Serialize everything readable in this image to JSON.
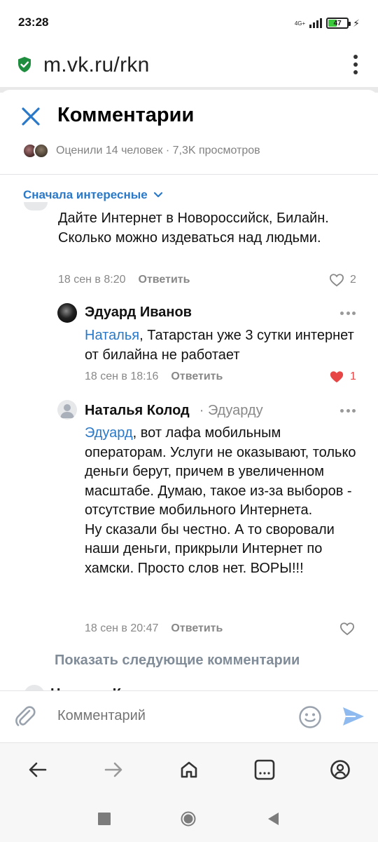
{
  "status": {
    "time": "23:28",
    "network": "4G+",
    "battery": "47",
    "battery_level": 0.47
  },
  "browser": {
    "url": "m.vk.ru/rkn"
  },
  "sheet": {
    "title": "Комментарии",
    "likers_text": "Оценили 14 человек · 7,3K просмотров",
    "sort_label": "Сначала интересные"
  },
  "comments": [
    {
      "text": "Дайте Интернет в Новороссийск, Билайн. Сколько можно издеваться над людьми.",
      "date": "18 сен в 8:20",
      "reply": "Ответить",
      "likes": "2"
    },
    {
      "author": "Эдуард Иванов",
      "mention": "Наталья",
      "text": ", Татарстан уже 3 сутки интернет от билайна не работает",
      "date": "18 сен в 18:16",
      "reply": "Ответить",
      "likes": "1"
    },
    {
      "author": "Наталья Колод",
      "reply_to": "· Эдуарду",
      "mention": "Эдуард",
      "text": ", вот лафа мобильным операторам. Услуги не оказывают, только деньги берут, причем в увеличенном масштабе. Думаю, такое из-за выборов - отсутствие мобильного Интернета.\nНу сказали бы честно. А то своровали наши деньги, прикрыли Интернет по хамски. Просто слов нет. ВОРЫ!!!",
      "date": "18 сен в 20:47",
      "reply": "Ответить"
    }
  ],
  "show_more": "Показать следующие комментарии",
  "peek_author": "Наталья Колод",
  "composer": {
    "placeholder": "Комментарий"
  },
  "colors": {
    "accent": "#2a79c9",
    "like_active": "#e64646",
    "muted": "#818c99"
  }
}
